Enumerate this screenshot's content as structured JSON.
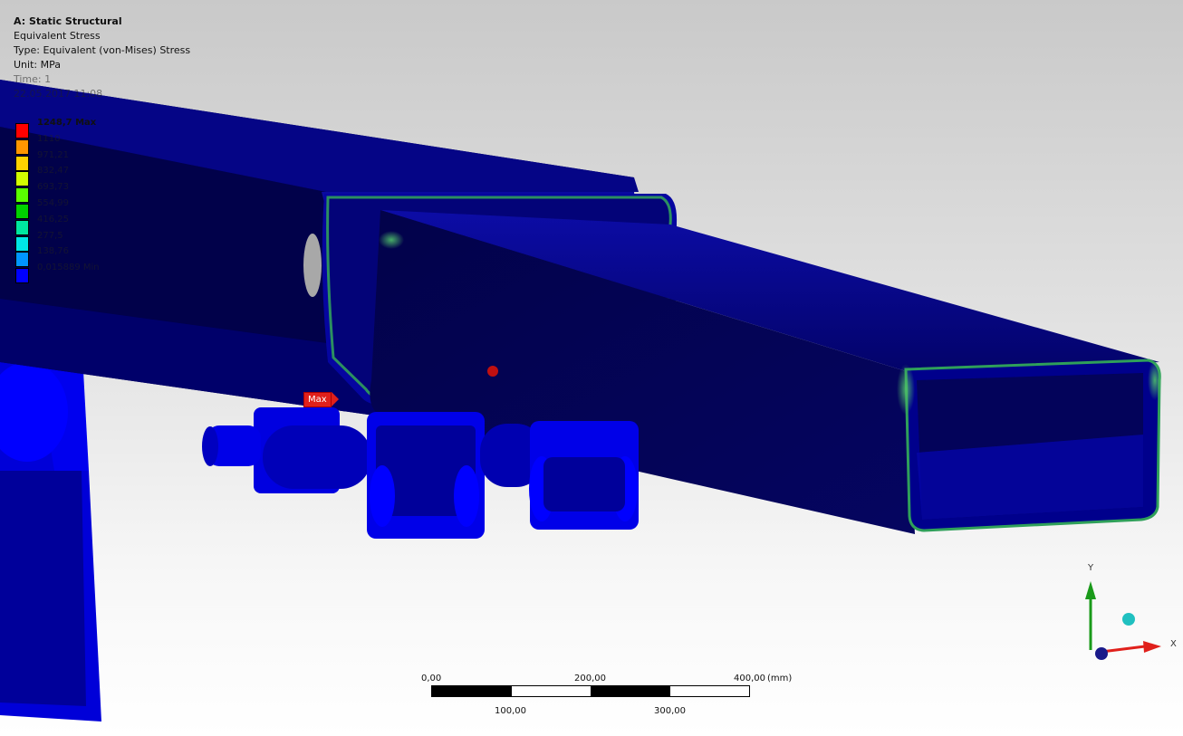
{
  "analysis": {
    "title": "A: Static Structural",
    "result_name": "Equivalent Stress",
    "type_line": "Type: Equivalent (von-Mises) Stress",
    "unit_line": "Unit: MPa",
    "time_line": "Time: 1",
    "date_line": "22.05.2017 11:08"
  },
  "legend": {
    "entries": [
      {
        "label": "1248,7 Max",
        "color": "#ff0000"
      },
      {
        "label": "1110",
        "color": "#ff9600"
      },
      {
        "label": "971,21",
        "color": "#ffd200"
      },
      {
        "label": "832,47",
        "color": "#d2ff00"
      },
      {
        "label": "693,73",
        "color": "#5aff00"
      },
      {
        "label": "554,99",
        "color": "#00d200"
      },
      {
        "label": "416,25",
        "color": "#00e6a0"
      },
      {
        "label": "277,5",
        "color": "#00e6e6"
      },
      {
        "label": "138,76",
        "color": "#0096ff"
      },
      {
        "label": "0,015889 Min",
        "color": "#0000ff"
      }
    ]
  },
  "max_marker": {
    "label": "Max"
  },
  "scale": {
    "unit": "(mm)",
    "top_labels": [
      "0,00",
      "200,00",
      "400,00"
    ],
    "bottom_labels": [
      "100,00",
      "300,00"
    ]
  },
  "triad": {
    "x_label": "X",
    "y_label": "Y",
    "x_color": "#e0201b",
    "y_color": "#1a9a1a",
    "z_color": "#1a1a8a",
    "iso_color": "#20c0c0"
  },
  "colors": {
    "model_dark": "#00004a",
    "model_mid": "#0a0a9a",
    "model_bright": "#0000ff",
    "stress_green": "#2fa05a"
  }
}
